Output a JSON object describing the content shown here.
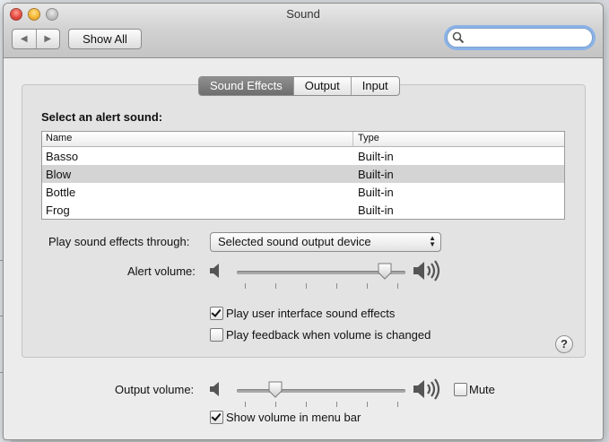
{
  "window": {
    "title": "Sound"
  },
  "toolbar": {
    "back_glyph": "◀",
    "forward_glyph": "▶",
    "show_all_label": "Show All",
    "search_value": "",
    "search_icon": "magnifier-icon"
  },
  "tabs": [
    {
      "label": "Sound Effects",
      "active": true
    },
    {
      "label": "Output",
      "active": false
    },
    {
      "label": "Input",
      "active": false
    }
  ],
  "sound_effects": {
    "heading": "Select an alert sound:",
    "columns": {
      "name": "Name",
      "type": "Type"
    },
    "rows": [
      {
        "name": "Basso",
        "type": "Built-in",
        "selected": false
      },
      {
        "name": "Blow",
        "type": "Built-in",
        "selected": true
      },
      {
        "name": "Bottle",
        "type": "Built-in",
        "selected": false
      },
      {
        "name": "Frog",
        "type": "Built-in",
        "selected": false
      }
    ],
    "play_through_label": "Play sound effects through:",
    "play_through_value": "Selected sound output device",
    "alert_volume_label": "Alert volume:",
    "alert_volume_level": 0.92,
    "ui_sounds_label": "Play user interface sound effects",
    "ui_sounds_checked": true,
    "feedback_label": "Play feedback when volume is changed",
    "feedback_checked": false,
    "help_label": "?"
  },
  "output": {
    "output_volume_label": "Output volume:",
    "output_volume_level": 0.2,
    "mute_label": "Mute",
    "mute_checked": false,
    "menubar_label": "Show volume in menu bar",
    "menubar_checked": true
  },
  "colors": {
    "active_tab": "#7a7a7a",
    "search_focus": "#8ab2e8",
    "selected_row": "#d4d4d4"
  }
}
